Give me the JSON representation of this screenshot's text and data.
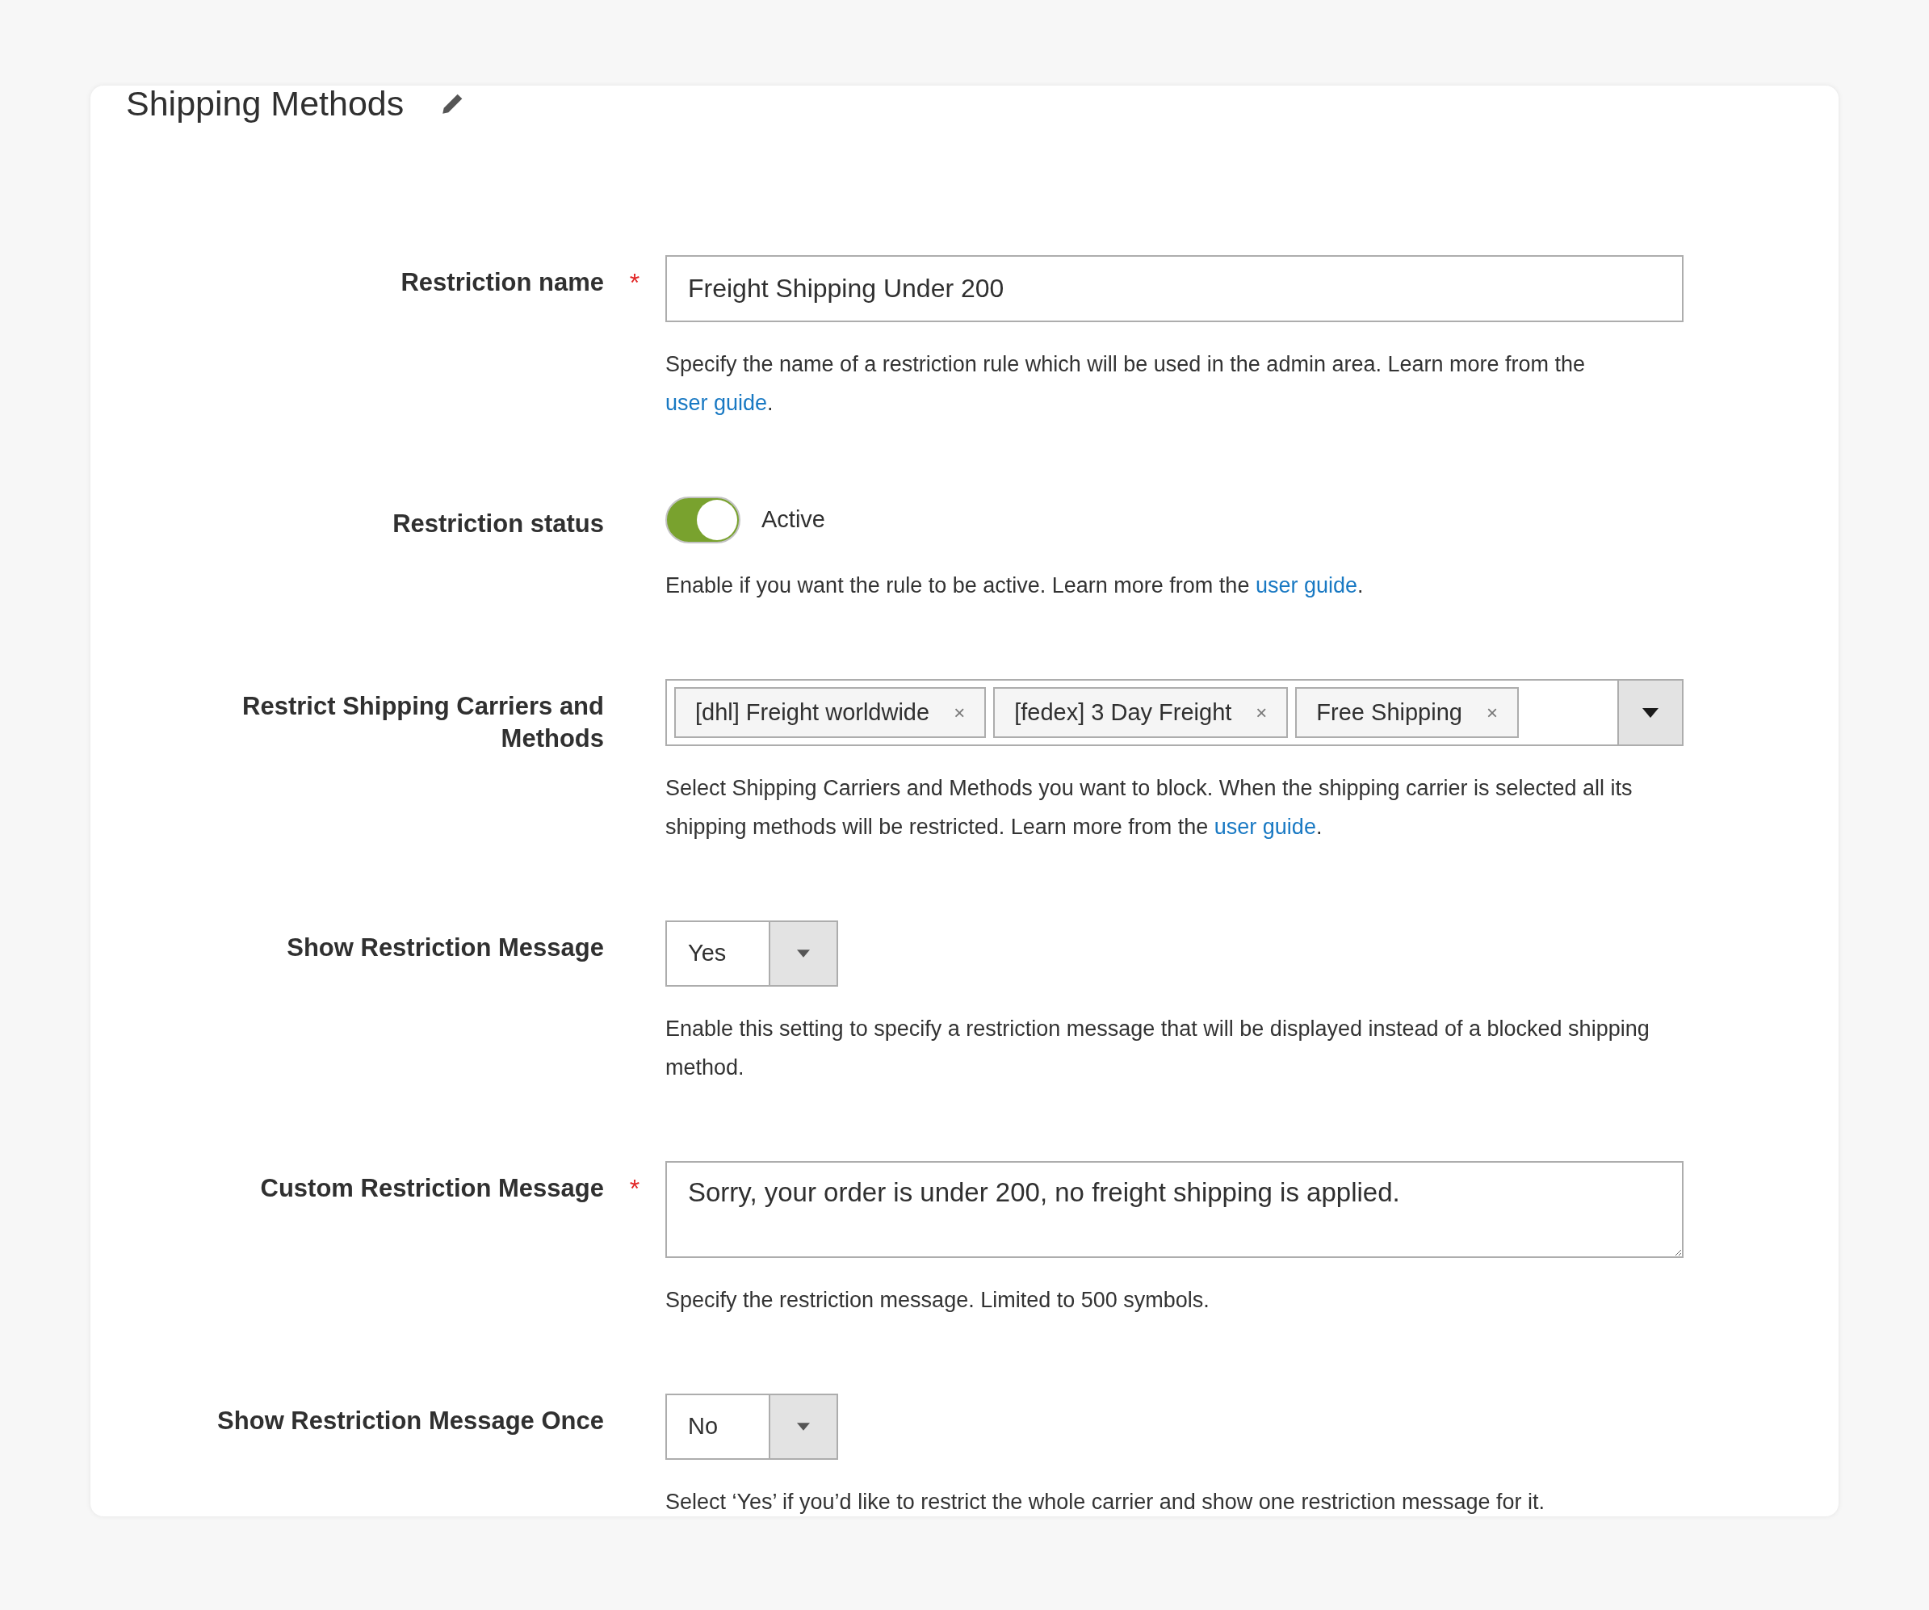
{
  "section": {
    "title": "Shipping Methods"
  },
  "fields": [
    {
      "kind": "text",
      "label": "Restriction name",
      "required_mark": "*",
      "value": "Freight Shipping Under 200",
      "help": {
        "text": "Specify the name of a restriction rule which will be used in the admin area. Learn more from the ",
        "link": "user guide",
        "after": "."
      }
    },
    {
      "kind": "toggle",
      "label": "Restriction status",
      "on": true,
      "value": "Active",
      "help": {
        "text": "Enable if you want the rule to be active. Learn more from the ",
        "link": "user guide",
        "after": "."
      }
    },
    {
      "kind": "multiselect",
      "label": "Restrict Shipping Carriers and Methods",
      "tags": [
        "[dhl] Freight worldwide",
        "[fedex] 3 Day Freight",
        "Free Shipping"
      ],
      "remove": "×",
      "help": {
        "text": "Select Shipping Carriers and Methods you want to block. When the shipping carrier is selected all its shipping methods will be restricted. Learn more from the ",
        "link": "user guide",
        "after": "."
      }
    },
    {
      "kind": "select",
      "label": "Show Restriction Message",
      "value": "Yes",
      "help": {
        "text": "Enable this setting to specify a restriction message that will be displayed instead of a blocked shipping method."
      }
    },
    {
      "kind": "textarea",
      "label": "Custom Restriction Message",
      "required_mark": "*",
      "value": "Sorry, your order is under 200, no freight shipping is applied.",
      "help": {
        "text": "Specify the restriction message. Limited to 500 symbols."
      }
    },
    {
      "kind": "select",
      "label": "Show Restriction Message Once",
      "value": "No",
      "help": {
        "text": "Select ‘Yes’ if you’d like to restrict the whole carrier and show one restriction message for it."
      }
    }
  ]
}
